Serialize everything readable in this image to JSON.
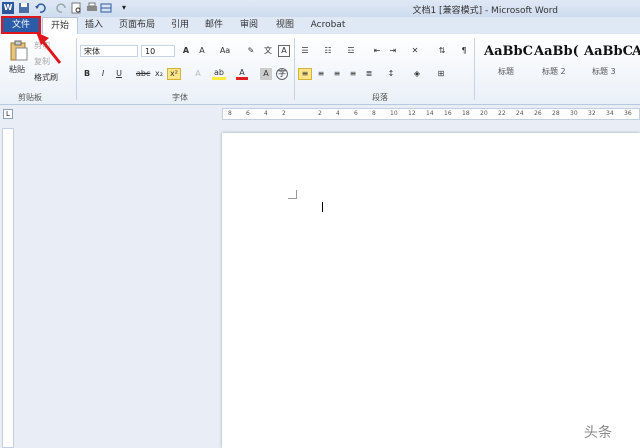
{
  "window": {
    "title": "文档1 [兼容模式] - Microsoft Word"
  },
  "tabs": [
    "文件",
    "开始",
    "插入",
    "页面布局",
    "引用",
    "邮件",
    "审阅",
    "视图",
    "Acrobat"
  ],
  "clipboard": {
    "paste": "粘贴",
    "cut": "剪切",
    "copy": "复制",
    "format_painter": "格式刷",
    "label": "剪贴板"
  },
  "font": {
    "name": "宋体",
    "size": "10",
    "label": "字体"
  },
  "paragraph": {
    "label": "段落"
  },
  "styles": [
    {
      "sample": "AaBbC",
      "name": "标题"
    },
    {
      "sample": "AaBb(",
      "name": "标题 2"
    },
    {
      "sample": "AaBbC",
      "name": "标题 3"
    },
    {
      "sample": "A",
      "name": ""
    }
  ],
  "ruler_ticks": [
    "8",
    "6",
    "4",
    "2",
    "",
    "2",
    "4",
    "6",
    "8",
    "10",
    "12",
    "14",
    "16",
    "18",
    "20",
    "22",
    "24",
    "26",
    "28",
    "30",
    "32",
    "34",
    "36"
  ],
  "watermark": "头条",
  "colors": {
    "file_tab": "#2a5ca8",
    "highlight_box": "#e0161c",
    "arrow": "#e0161c"
  }
}
